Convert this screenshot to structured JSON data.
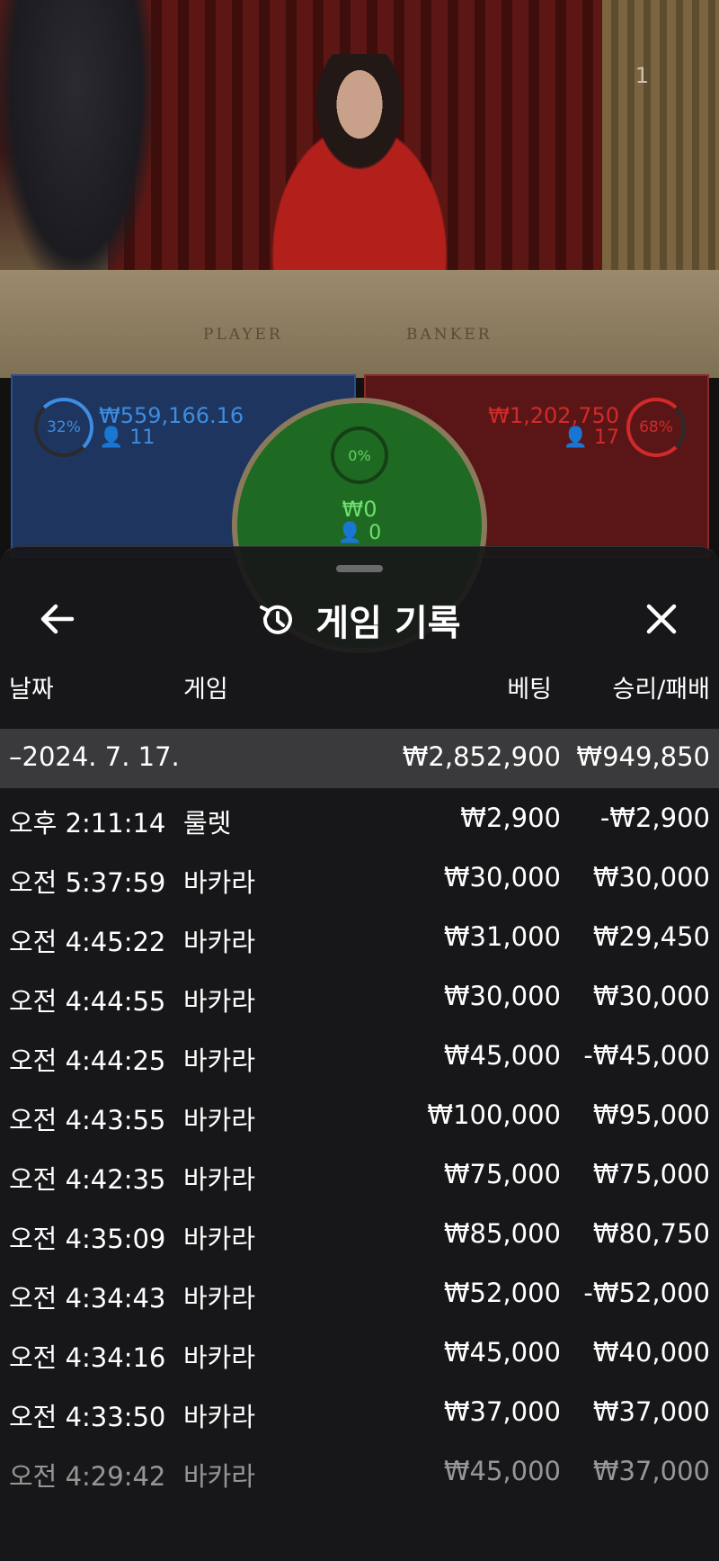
{
  "stream": {
    "number": "1",
    "table_labels": [
      "PLAYER",
      "BANKER"
    ]
  },
  "bets": {
    "player": {
      "percent": "32%",
      "amount": "₩559,166.16",
      "count": "11",
      "color": "#3d8de0"
    },
    "tie": {
      "percent": "0%",
      "amount": "₩0",
      "count": "0",
      "color": "#6fe06f"
    },
    "banker": {
      "percent": "68%",
      "amount": "₩1,202,750",
      "count": "17",
      "color": "#d02a2a"
    }
  },
  "modal": {
    "title": "게임 기록",
    "icons": {
      "back": "arrow-left-icon",
      "history": "history-icon",
      "close": "close-icon"
    },
    "columns": {
      "date": "날짜",
      "game": "게임",
      "bet": "베팅",
      "result": "승리/패배"
    },
    "date_group": {
      "label": "–2024. 7. 17.",
      "bet": "₩2,852,900",
      "result": "₩949,850"
    },
    "rows": [
      {
        "time": "오후 2:11:14",
        "game": "룰렛",
        "bet": "₩2,900",
        "result": "-₩2,900"
      },
      {
        "time": "오전 5:37:59",
        "game": "바카라",
        "bet": "₩30,000",
        "result": "₩30,000"
      },
      {
        "time": "오전 4:45:22",
        "game": "바카라",
        "bet": "₩31,000",
        "result": "₩29,450"
      },
      {
        "time": "오전 4:44:55",
        "game": "바카라",
        "bet": "₩30,000",
        "result": "₩30,000"
      },
      {
        "time": "오전 4:44:25",
        "game": "바카라",
        "bet": "₩45,000",
        "result": "-₩45,000"
      },
      {
        "time": "오전 4:43:55",
        "game": "바카라",
        "bet": "₩100,000",
        "result": "₩95,000"
      },
      {
        "time": "오전 4:42:35",
        "game": "바카라",
        "bet": "₩75,000",
        "result": "₩75,000"
      },
      {
        "time": "오전 4:35:09",
        "game": "바카라",
        "bet": "₩85,000",
        "result": "₩80,750"
      },
      {
        "time": "오전 4:34:43",
        "game": "바카라",
        "bet": "₩52,000",
        "result": "-₩52,000"
      },
      {
        "time": "오전 4:34:16",
        "game": "바카라",
        "bet": "₩45,000",
        "result": "₩40,000"
      },
      {
        "time": "오전 4:33:50",
        "game": "바카라",
        "bet": "₩37,000",
        "result": "₩37,000"
      },
      {
        "time": "오전 4:29:42",
        "game": "바카라",
        "bet": "₩45,000",
        "result": "₩37,000"
      }
    ]
  }
}
